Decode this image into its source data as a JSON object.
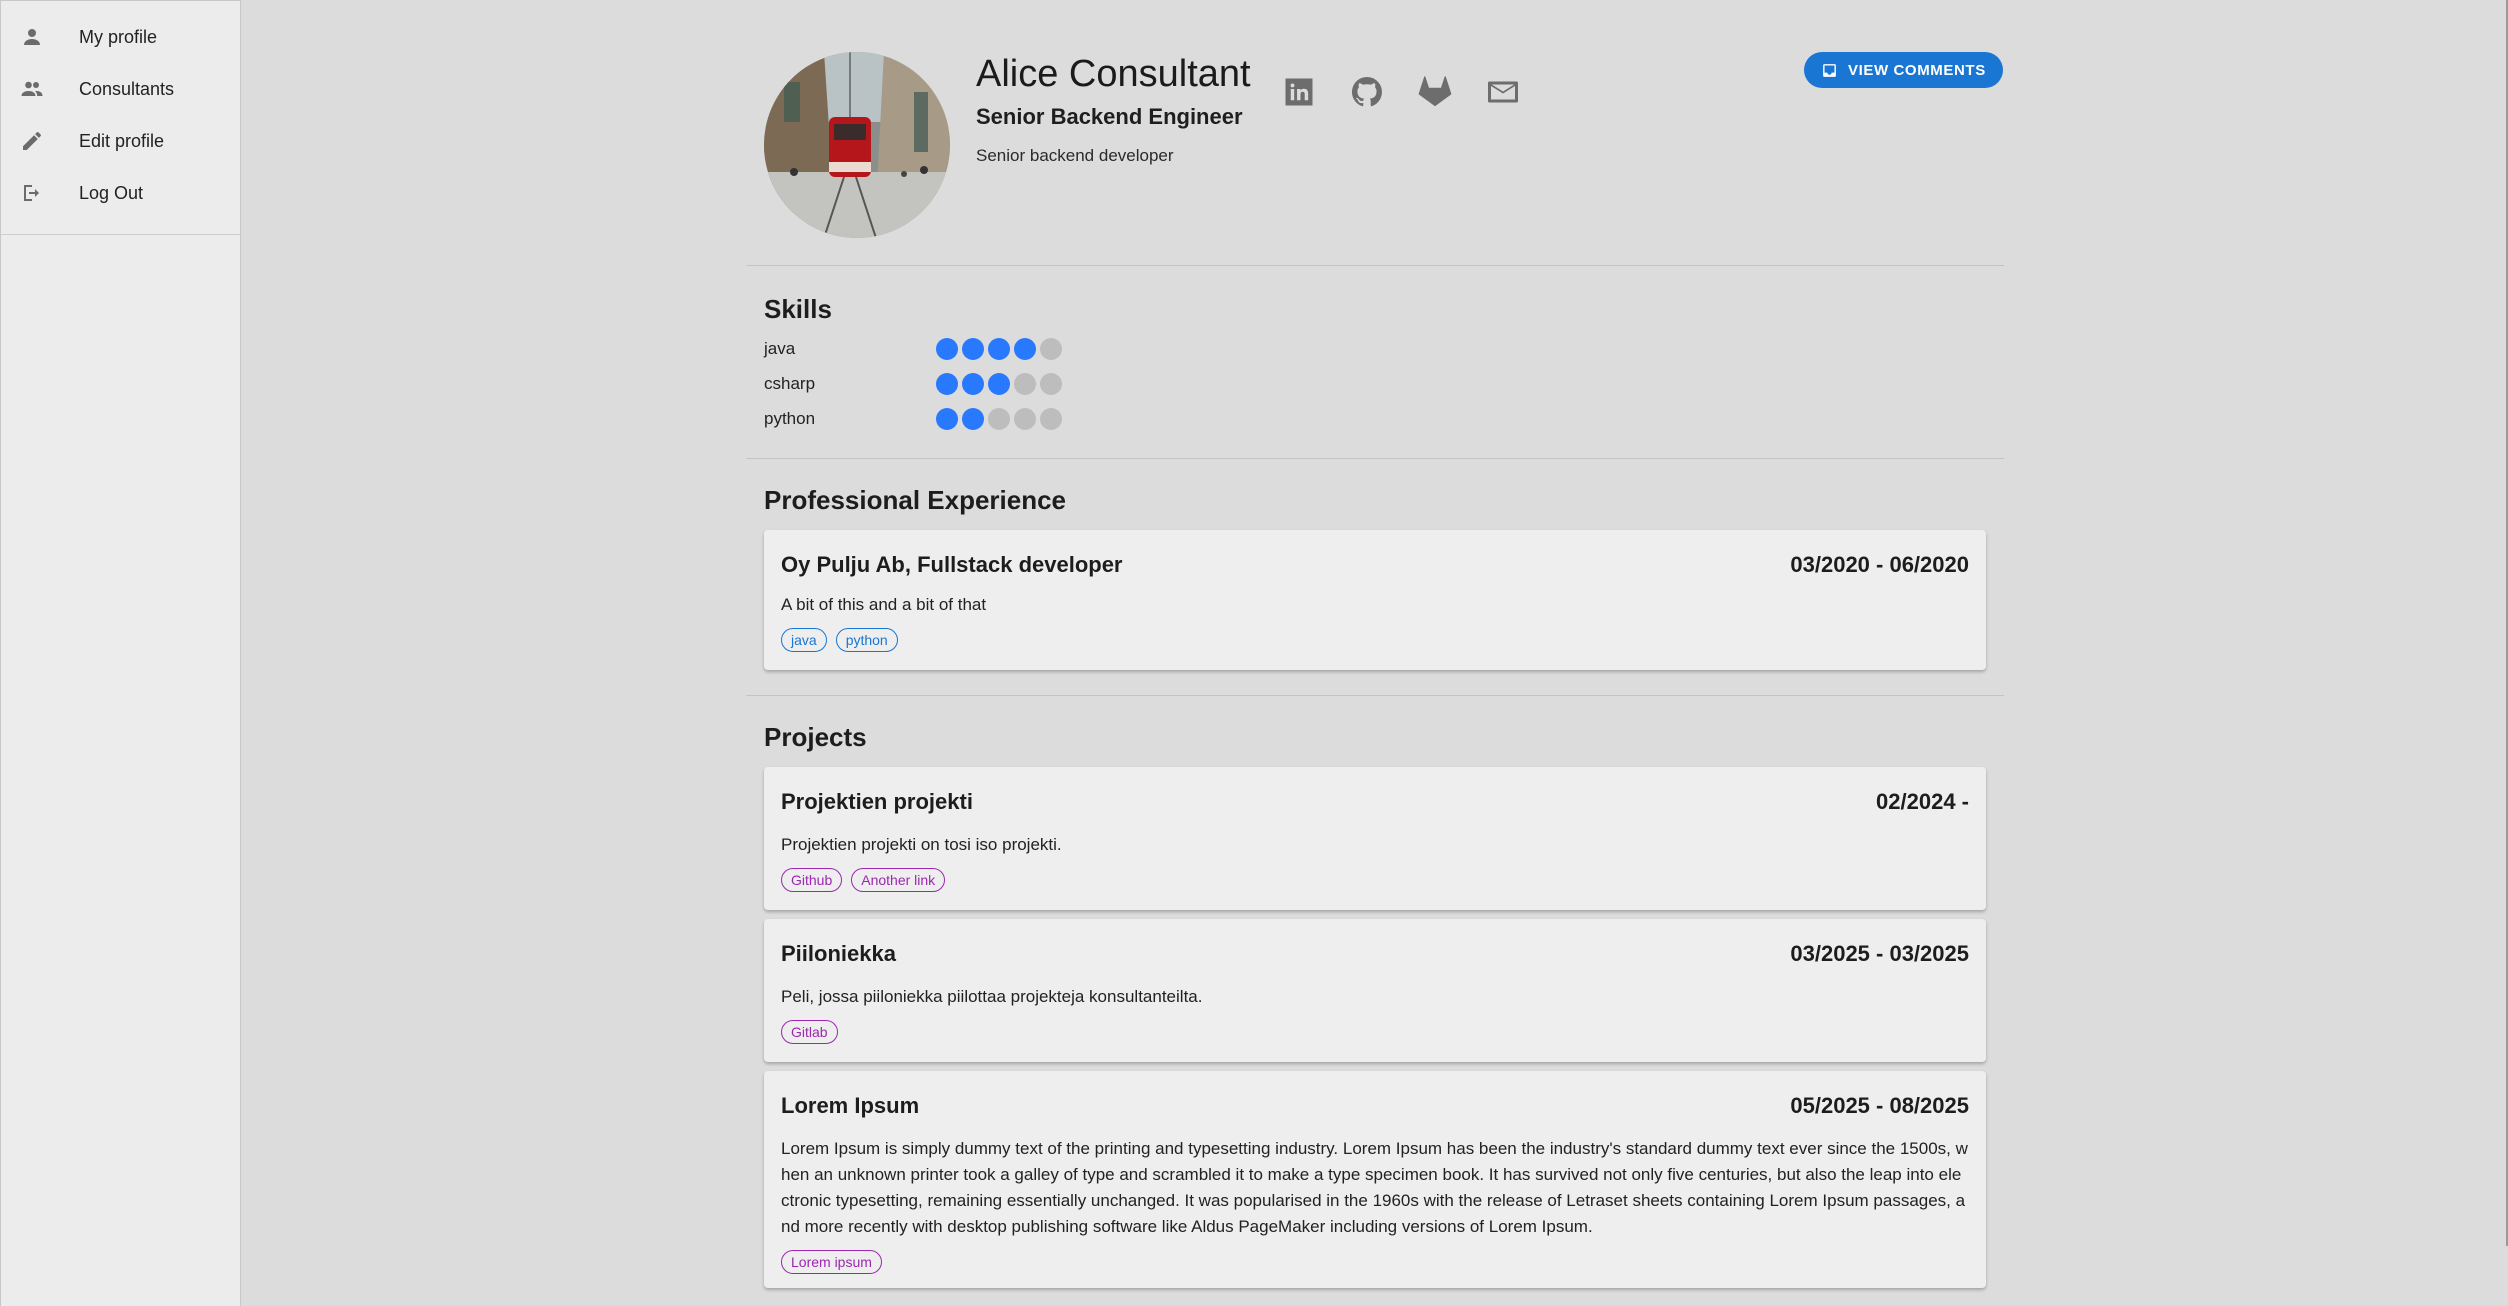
{
  "sidebar": {
    "items": [
      {
        "label": "My profile",
        "icon": "person-icon"
      },
      {
        "label": "Consultants",
        "icon": "people-icon"
      },
      {
        "label": "Edit profile",
        "icon": "pencil-icon"
      },
      {
        "label": "Log Out",
        "icon": "logout-icon"
      }
    ]
  },
  "profile": {
    "name": "Alice Consultant",
    "title": "Senior Backend Engineer",
    "bio": "Senior backend developer",
    "socials": [
      "linkedin-icon",
      "github-icon",
      "gitlab-icon",
      "email-icon"
    ],
    "view_comments_label": "VIEW COMMENTS"
  },
  "skills": {
    "heading": "Skills",
    "max_level": 5,
    "items": [
      {
        "name": "java",
        "level": 4
      },
      {
        "name": "csharp",
        "level": 3
      },
      {
        "name": "python",
        "level": 2
      }
    ]
  },
  "experience": {
    "heading": "Professional Experience",
    "items": [
      {
        "title": "Oy Pulju Ab, Fullstack developer",
        "dates": "03/2020 - 06/2020",
        "description": "A bit of this and a bit of that",
        "tags": [
          "java",
          "python"
        ]
      }
    ]
  },
  "projects": {
    "heading": "Projects",
    "items": [
      {
        "title": "Projektien projekti",
        "dates": "02/2024 -",
        "description": "Projektien projekti on tosi iso projekti.",
        "links": [
          "Github",
          "Another link"
        ]
      },
      {
        "title": "Piiloniekka",
        "dates": "03/2025 - 03/2025",
        "description": "Peli, jossa piiloniekka piilottaa projekteja konsultanteilta.",
        "links": [
          "Gitlab"
        ]
      },
      {
        "title": "Lorem Ipsum",
        "dates": "05/2025 - 08/2025",
        "description": "Lorem Ipsum is simply dummy text of the printing and typesetting industry. Lorem Ipsum has been the industry's standard dummy text ever since the 1500s, when an unknown printer took a galley of type and scrambled it to make a type specimen book. It has survived not only five centuries, but also the leap into electronic typesetting, remaining essentially unchanged. It was popularised in the 1960s with the release of Letraset sheets containing Lorem Ipsum passages, and more recently with desktop publishing software like Aldus PageMaker including versions of Lorem Ipsum.",
        "links": [
          "Lorem ipsum"
        ]
      }
    ]
  },
  "colors": {
    "accent": "#1976d2",
    "skill_dot_on": "#2979ff",
    "skill_dot_off": "#bdbdbd",
    "link_chip": "#9c27b0"
  }
}
